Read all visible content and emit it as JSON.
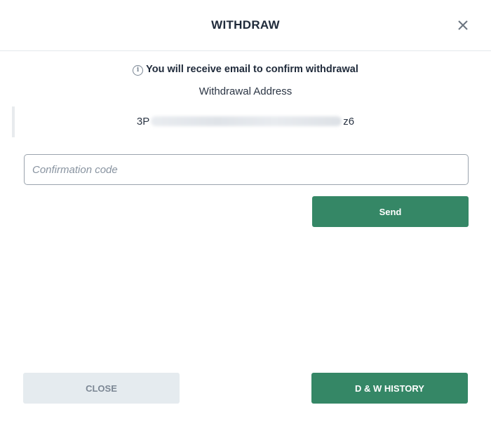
{
  "modal": {
    "title": "WITHDRAW",
    "close_icon": "close-icon"
  },
  "notice": {
    "icon": "info-icon",
    "icon_glyph": "i",
    "text": "You will receive email to confirm withdrawal"
  },
  "address": {
    "label": "Withdrawal Address",
    "value_prefix": "3P",
    "value_suffix": "z6"
  },
  "confirmation": {
    "placeholder": "Confirmation code",
    "value": ""
  },
  "buttons": {
    "send": "Send",
    "close": "CLOSE",
    "history": "D & W HISTORY"
  },
  "colors": {
    "primary_green": "#358766",
    "secondary_gray": "#e5ebef",
    "text_dark": "#1f2a3a"
  }
}
